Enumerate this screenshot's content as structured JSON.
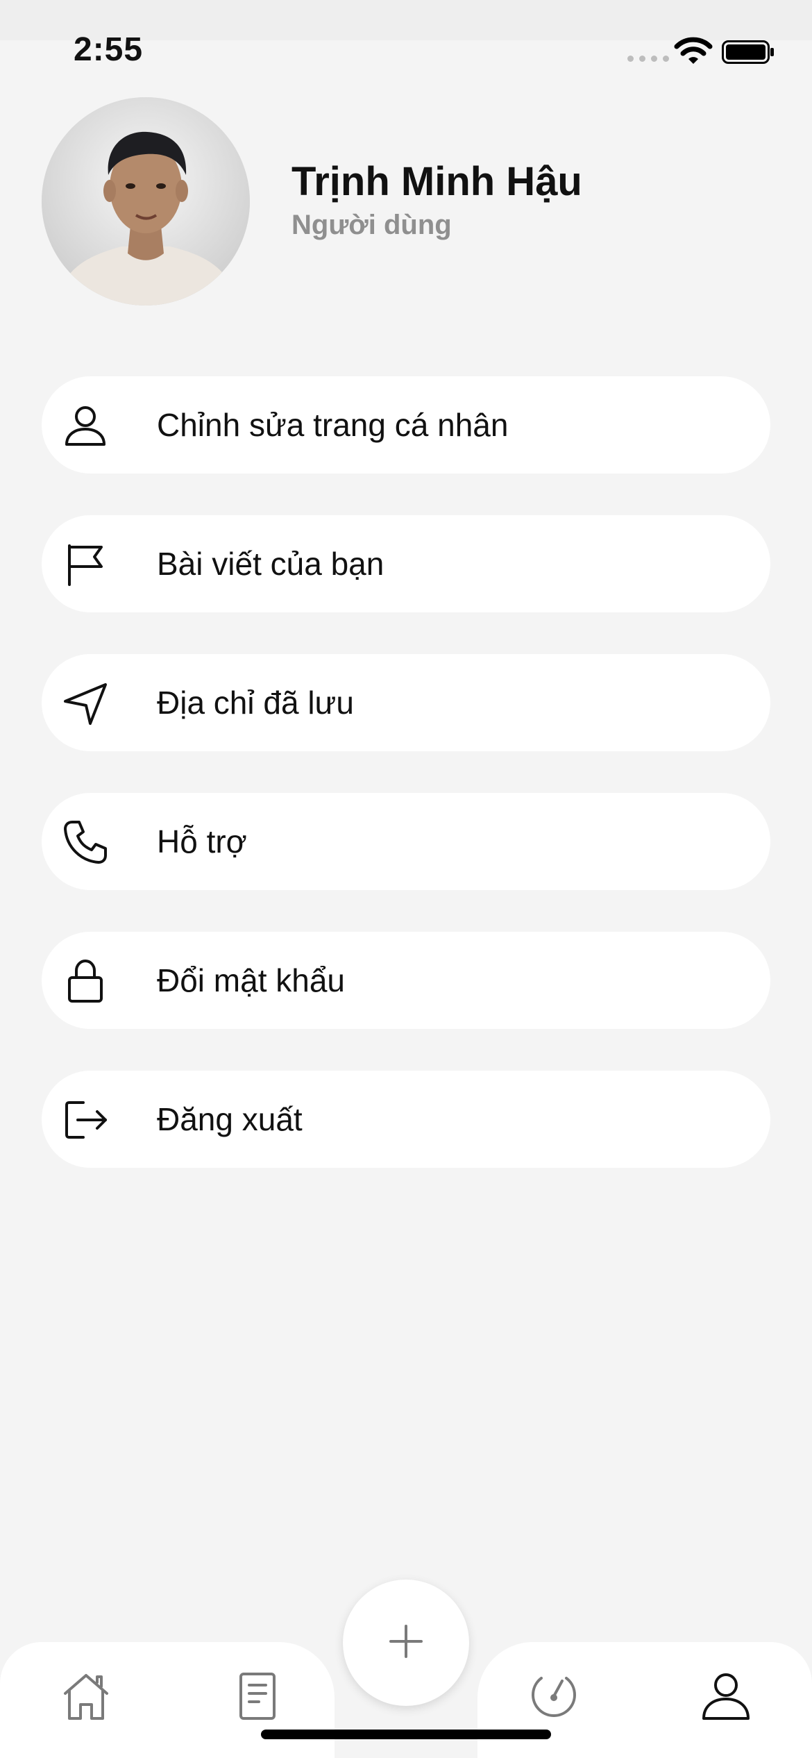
{
  "status_bar": {
    "time": "2:55"
  },
  "profile": {
    "name": "Trịnh Minh Hậu",
    "role": "Người dùng"
  },
  "menu": {
    "items": [
      {
        "label": "Chỉnh sửa trang cá nhân",
        "icon": "user-icon"
      },
      {
        "label": "Bài viết của bạn",
        "icon": "flag-icon"
      },
      {
        "label": "Địa chỉ đã lưu",
        "icon": "navigation-icon"
      },
      {
        "label": "Hỗ trợ",
        "icon": "phone-icon"
      },
      {
        "label": "Đổi mật khẩu",
        "icon": "lock-icon"
      },
      {
        "label": "Đăng xuất",
        "icon": "logout-icon"
      }
    ]
  },
  "tabbar": {
    "tabs": [
      {
        "icon": "home-icon"
      },
      {
        "icon": "document-icon"
      },
      {
        "icon": "add-icon"
      },
      {
        "icon": "gauge-icon"
      },
      {
        "icon": "profile-icon"
      }
    ]
  },
  "colors": {
    "background": "#f4f4f4",
    "card": "#ffffff",
    "text": "#111111",
    "subtext": "#8f8f8f",
    "tab_icon": "#7a7a7a"
  }
}
